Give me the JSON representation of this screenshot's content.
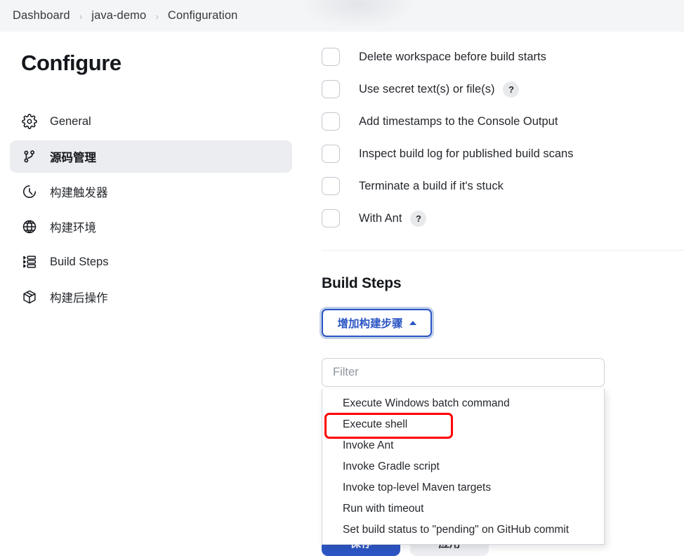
{
  "breadcrumb": {
    "items": [
      "Dashboard",
      "java-demo",
      "Configuration"
    ],
    "separator": "›"
  },
  "sidebar": {
    "title": "Configure",
    "items": [
      {
        "label": "General",
        "icon": "gear-icon",
        "selected": false
      },
      {
        "label": "源码管理",
        "icon": "git-branch-icon",
        "selected": true
      },
      {
        "label": "构建触发器",
        "icon": "clock-icon",
        "selected": false
      },
      {
        "label": "构建环境",
        "icon": "globe-icon",
        "selected": false
      },
      {
        "label": "Build Steps",
        "icon": "list-steps-icon",
        "selected": false
      },
      {
        "label": "构建后操作",
        "icon": "package-icon",
        "selected": false
      }
    ]
  },
  "main": {
    "checkboxes": [
      {
        "label": "Delete workspace before build starts",
        "checked": false,
        "help": false
      },
      {
        "label": "Use secret text(s) or file(s)",
        "checked": false,
        "help": true
      },
      {
        "label": "Add timestamps to the Console Output",
        "checked": false,
        "help": false
      },
      {
        "label": "Inspect build log for published build scans",
        "checked": false,
        "help": false
      },
      {
        "label": "Terminate a build if it's stuck",
        "checked": false,
        "help": false
      },
      {
        "label": "With Ant",
        "checked": false,
        "help": true
      }
    ],
    "help_glyph": "?",
    "build_steps": {
      "title": "Build Steps",
      "add_button_label": "增加构建步骤",
      "add_button_caret": "caret-up-icon",
      "filter_placeholder": "Filter",
      "filter_value": "",
      "menu_items": [
        {
          "label": "Execute Windows batch command",
          "highlighted": false
        },
        {
          "label": "Execute shell",
          "highlighted": true
        },
        {
          "label": "Invoke Ant",
          "highlighted": false
        },
        {
          "label": "Invoke Gradle script",
          "highlighted": false
        },
        {
          "label": "Invoke top-level Maven targets",
          "highlighted": false
        },
        {
          "label": "Run with timeout",
          "highlighted": false
        },
        {
          "label": "Set build status to \"pending\" on GitHub commit",
          "highlighted": false
        }
      ]
    },
    "actions": {
      "save_label": "保存",
      "apply_label": "应用"
    }
  },
  "colors": {
    "accent": "#2b55c4",
    "highlight_box": "#ff0000",
    "selected_nav_bg": "#ebedf1",
    "breadcrumb_bg": "#f4f5f7"
  }
}
